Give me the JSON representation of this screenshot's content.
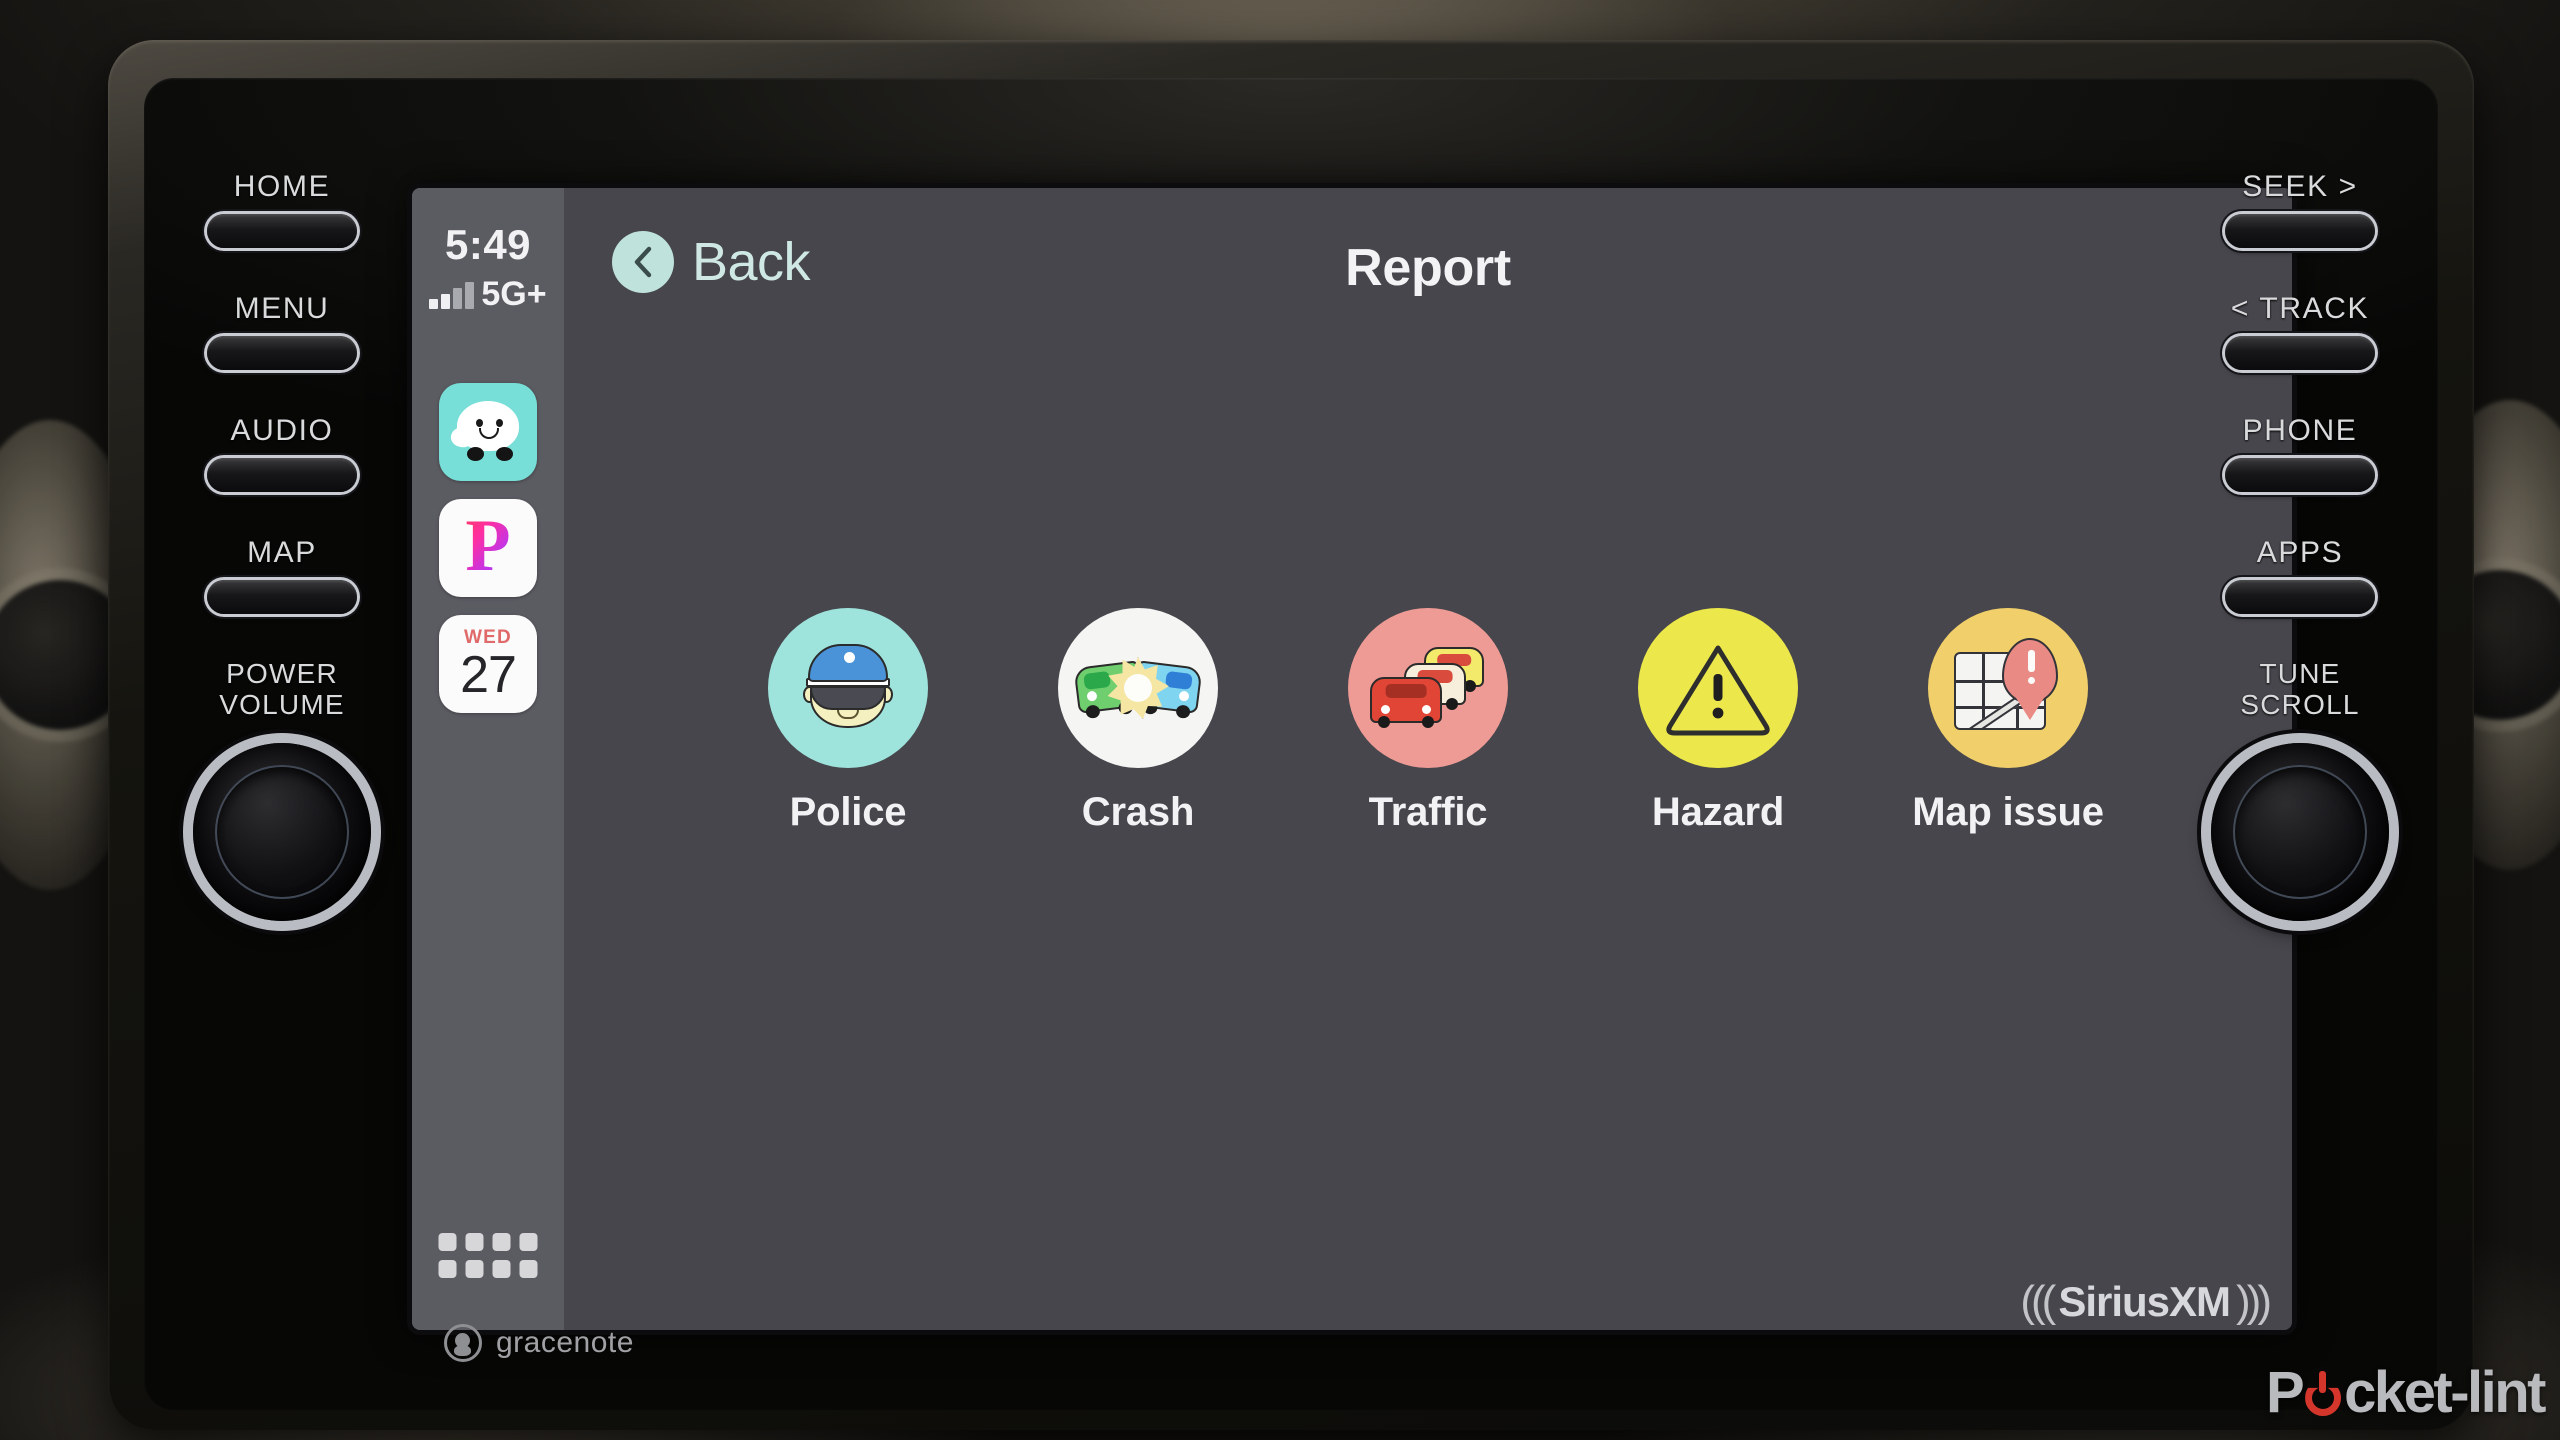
{
  "device": {
    "left_keys": [
      {
        "label": "HOME",
        "name": "home"
      },
      {
        "label": "MENU",
        "name": "menu"
      },
      {
        "label": "AUDIO",
        "name": "audio"
      },
      {
        "label": "MAP",
        "name": "map"
      }
    ],
    "left_knob": {
      "line1": "POWER",
      "line2": "VOLUME"
    },
    "right_keys": [
      {
        "label": "SEEK >",
        "name": "seek"
      },
      {
        "label": "< TRACK",
        "name": "track"
      },
      {
        "label": "PHONE",
        "name": "phone"
      },
      {
        "label": "APPS",
        "name": "apps"
      }
    ],
    "right_knob": {
      "line1": "TUNE",
      "line2": "SCROLL"
    },
    "branding": {
      "gracenote": "gracenote",
      "siriusxm_left_wave": "(((",
      "siriusxm_text": "SiriusXM",
      "siriusxm_right_wave": ")))"
    }
  },
  "carplay": {
    "status": {
      "time": "5:49",
      "network": "5G+",
      "signal_bars": 4
    },
    "sidebar": {
      "apps": [
        {
          "name": "waze",
          "label": "Waze",
          "tile_color": "#77dfd7"
        },
        {
          "name": "pandora",
          "label": "Pandora",
          "tile_color": "#fbfbfb"
        },
        {
          "name": "calendar",
          "label": "Calendar",
          "tile_color": "#fbfbfb",
          "day_of_week": "WED",
          "day_number": "27"
        }
      ],
      "grid_button_label": "Apps"
    },
    "header": {
      "back_label": "Back",
      "title": "Report"
    },
    "report_options": [
      {
        "name": "police",
        "label": "Police",
        "circle_color": "#9fe3dd"
      },
      {
        "name": "crash",
        "label": "Crash",
        "circle_color": "#f5f5f3"
      },
      {
        "name": "traffic",
        "label": "Traffic",
        "circle_color": "#ef9b95"
      },
      {
        "name": "hazard",
        "label": "Hazard",
        "circle_color": "#ece84c"
      },
      {
        "name": "map-issue",
        "label": "Map issue",
        "circle_color": "#f1cf6a"
      }
    ]
  },
  "watermark": {
    "part1": "P",
    "part2": "cket-lint"
  }
}
